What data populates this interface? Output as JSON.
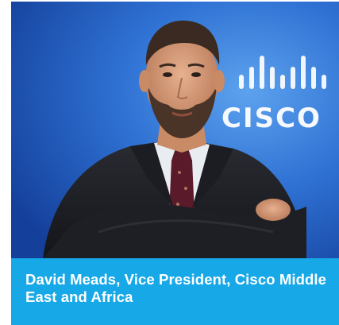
{
  "photo": {
    "subject": "portrait",
    "background_color": "#2d6fd0",
    "logo": {
      "wordmark": "CISCO",
      "color": "#ffffff"
    }
  },
  "caption": {
    "text": "David Meads, Vice President, Cisco Middle East and Africa",
    "background_color": "#17a8e8",
    "text_color": "#ffffff"
  }
}
